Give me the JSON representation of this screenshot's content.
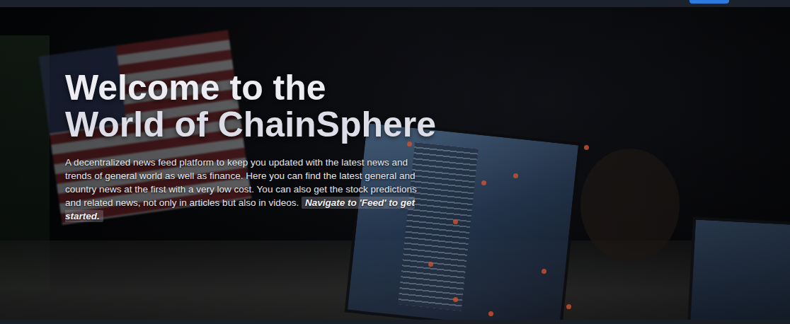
{
  "hero": {
    "title_lines": [
      "Welcome to the",
      "World of ChainSphere"
    ],
    "description": "A decentralized news feed platform to keep you updated with the latest news and trends of general world as well as finance. Here you can find the latest general and country news at the first with a very low cost. You can also get the stock predictions and related news, not only in articles but also in videos.",
    "cta": "Navigate to 'Feed' to get started."
  }
}
